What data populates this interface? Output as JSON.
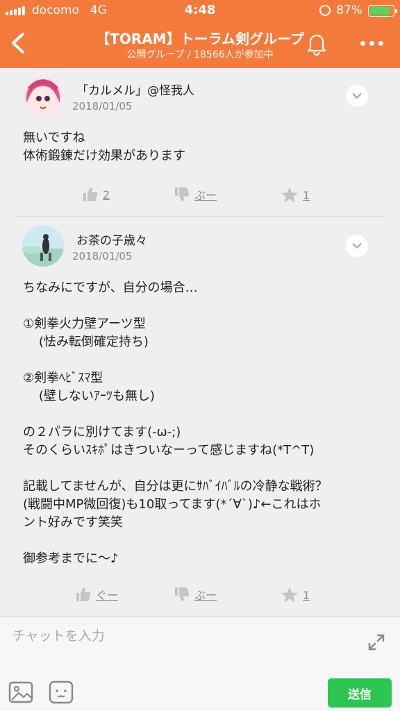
{
  "status_bar": {
    "carrier": "docomo",
    "network": "4G",
    "time": "4:48",
    "battery": "87%",
    "battery_level": 0.87
  },
  "header": {
    "title": "【TORAM】トーラム剣グループ",
    "subtitle": "公開グループ / 18566人が参加中",
    "back_icon": "chevron-left-icon",
    "bell_icon": "bell-icon",
    "more_icon": "more-icon"
  },
  "posts": [
    {
      "author": "「カルメル」@怪我人",
      "date": "2018/01/05",
      "body": "無いですね\n体術鍛錬だけ効果があります",
      "like_label": "2",
      "dislike_label": "ぶー",
      "star_label": "1"
    },
    {
      "author": "お茶の子歳々",
      "date": "2018/01/05",
      "body": "ちなみにですが、自分の場合…\n\n①剣拳火力壁アーツ型\n    (怯み転倒確定持ち)\n\n②剣拳ﾍﾋﾞｽﾏ型\n    (壁しないｱｰﾂも無し)\n\nの２パラに別けてます(-ω-;)\nそのくらいｽｷﾎﾟはきついなーって感じますね(*T^T)\n\n記載してませんが、自分は更にｻﾊﾞｲﾊﾞﾙの冷静な戦術？\n(戦闘中MP微回復)も10取ってます(*´∀`)♪←これはホ\nント好みです笑笑\n\n御参考までに〜♪",
      "like_label": "ぐー",
      "dislike_label": "ぶー",
      "star_label": "1"
    }
  ],
  "input_bar": {
    "placeholder": "チャットを入力",
    "send_label": "送信"
  },
  "colors": {
    "accent": "#f47a3c",
    "send": "#2dc653",
    "muted": "#888888"
  }
}
